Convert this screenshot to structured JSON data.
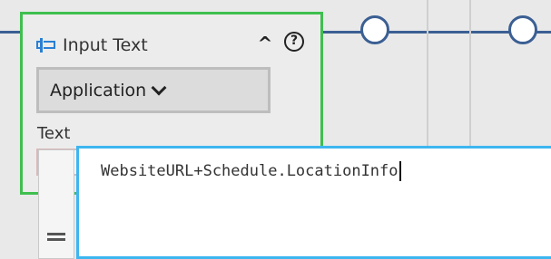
{
  "activity": {
    "title": "Input Text",
    "icon": "input-text-icon",
    "application_label": "Application",
    "text_label": "Text"
  },
  "expression_editor": {
    "value": "WebsiteURL+Schedule.LocationInfo"
  },
  "colors": {
    "activity_border": "#3fbf4f",
    "connector": "#3b5f93",
    "editor_border": "#3db6f0",
    "icon_accent": "#2a7fd4"
  }
}
